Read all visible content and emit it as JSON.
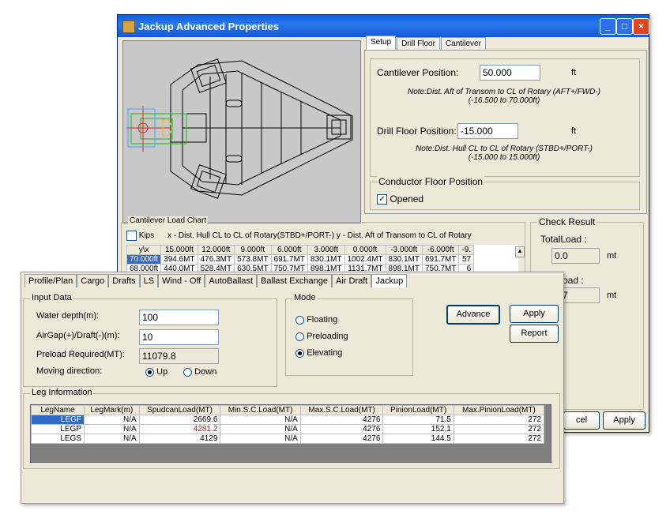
{
  "back_window": {
    "title": "Jackup Advanced Properties",
    "tabs": [
      "Setup",
      "Drill Floor",
      "Cantilever"
    ],
    "cantilever_label": "Cantilever Position:",
    "cantilever_value": "50.000",
    "cantilever_unit": "ft",
    "cantilever_note_1": "Note:Dist. Aft of Transom to CL of Rotary   (AFT+/FWD-)",
    "cantilever_note_2": "(-16.500 to 70.000ft)",
    "drill_label": "Drill Floor Position:",
    "drill_value": "-15.000",
    "drill_unit": "ft",
    "drill_note_1": "Note:Dist. Hull CL to CL of Rotary   (STBD+/PORT-)",
    "drill_note_2": "(-15.000 to 15.000ft)",
    "conductor_title": "Conductor Floor Position",
    "opened_label": "Opened",
    "load_chart_title": "Cantilever Load Chart",
    "kips_label": "Kips",
    "load_chart_desc": "x - Dist. Hull CL to CL of Rotary(STBD+/PORT-)   y - Dist. Aft of Transom to CL of Rotary",
    "grid_header": [
      "y\\x",
      "15.000ft",
      "12.000ft",
      "9.000ft",
      "6.000ft",
      "3.000ft",
      "0.000ft",
      "-3.000ft",
      "-6.000ft",
      "-9."
    ],
    "grid_rows": [
      [
        "70.000ft",
        "394.6MT",
        "476.3MT",
        "573.8MT",
        "691.7MT",
        "830.1MT",
        "1002.4MT",
        "830.1MT",
        "691.7MT",
        "57"
      ],
      [
        "68.000ft",
        "440.0MT",
        "528.4MT",
        "630.5MT",
        "750.7MT",
        "898.1MT",
        "1131.7MT",
        "898.1MT",
        "750.7MT",
        "6"
      ]
    ],
    "check_result_title": "Check Result",
    "total_load_label": "TotalLoad :",
    "total_load_value": "0.0",
    "total_load_unit": "mt",
    "second_load_label": "oad :",
    "second_load_value": "3.7",
    "second_load_unit": "mt",
    "cancel_label": "cel",
    "apply_label": "Apply"
  },
  "front_window": {
    "tabs": [
      "Profile/Plan",
      "Cargo",
      "Drafts",
      "LS",
      "Wind - Off",
      "AutoBallast",
      "Ballast Exchange",
      "Air Draft",
      "Jackup"
    ],
    "input_title": "Input Data",
    "water_depth_label": "Water depth(m):",
    "water_depth_value": "100",
    "airgap_label": "AirGap(+)/Draft(-)(m):",
    "airgap_value": "10",
    "preload_label": "Preload Required(MT):",
    "preload_value": "11079.8",
    "moving_label": "Moving direction:",
    "up_label": "Up",
    "down_label": "Down",
    "mode_title": "Mode",
    "floating_label": "Floating",
    "preloading_label": "Preloading",
    "elevating_label": "Elevating",
    "advance_label": "Advance",
    "apply_label": "Apply",
    "report_label": "Report",
    "leg_info_title": "Leg Information",
    "leg_header": [
      "LegName",
      "LegMark(m)",
      "SpudcanLoad(MT)",
      "Min.S.C.Load(MT)",
      "Max.S.C.Load(MT)",
      "PinionLoad(MT)",
      "Max.PinionLoad(MT)"
    ],
    "leg_rows": [
      [
        "LEGF",
        "N/A",
        "2669.6",
        "N/A",
        "4276",
        "71.5",
        "272"
      ],
      [
        "LEGP",
        "N/A",
        "4281.2",
        "N/A",
        "4276",
        "152.1",
        "272"
      ],
      [
        "LEGS",
        "N/A",
        "4129",
        "N/A",
        "4276",
        "144.5",
        "272"
      ]
    ]
  },
  "colors": {
    "title_bar": "#1658d8",
    "selected_row": "#316ac5",
    "over_limit": "#b22222",
    "green_outline": "#18b818",
    "red_outline": "#e02020",
    "hull_fill": "#c8c8c8"
  }
}
